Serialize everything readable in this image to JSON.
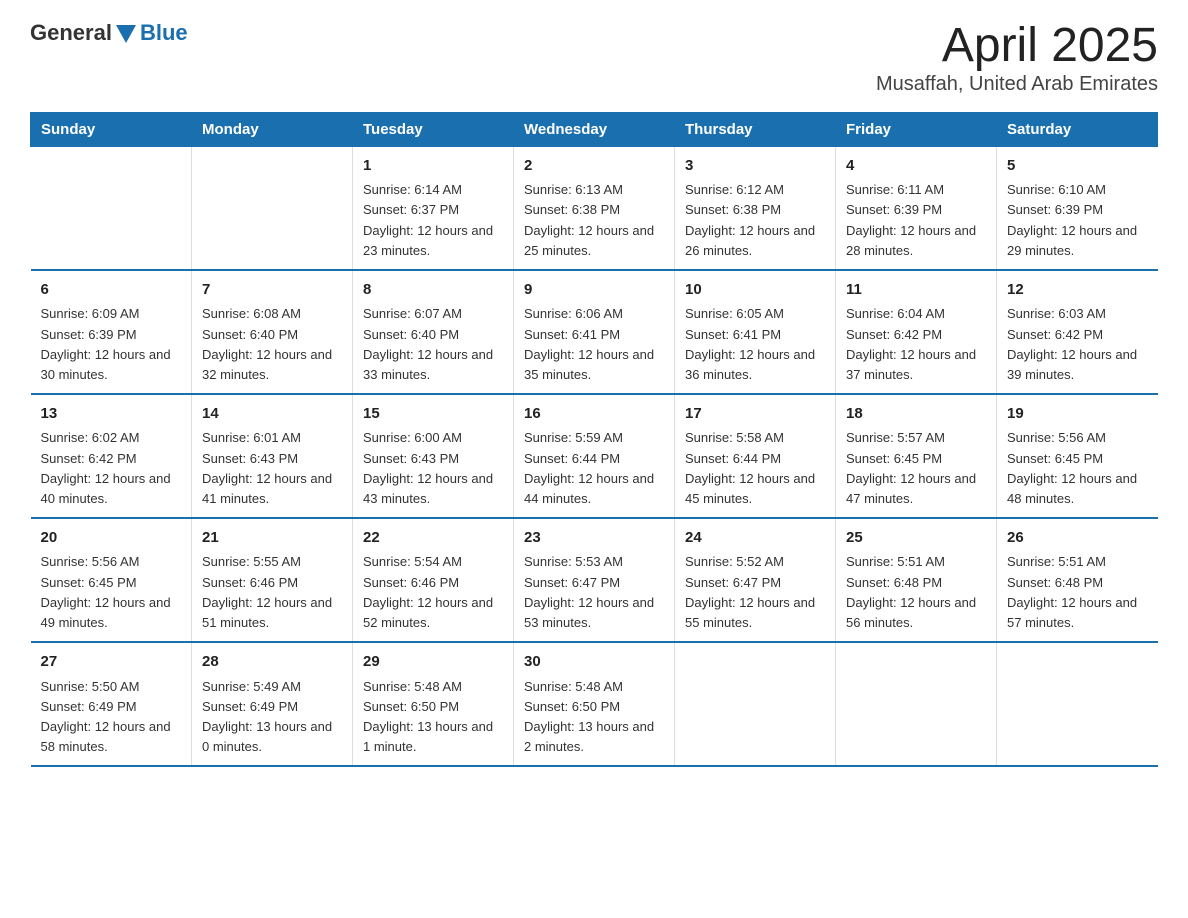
{
  "logo": {
    "general": "General",
    "blue": "Blue"
  },
  "title": "April 2025",
  "subtitle": "Musaffah, United Arab Emirates",
  "headers": [
    "Sunday",
    "Monday",
    "Tuesday",
    "Wednesday",
    "Thursday",
    "Friday",
    "Saturday"
  ],
  "weeks": [
    [
      {
        "day": "",
        "sunrise": "",
        "sunset": "",
        "daylight": ""
      },
      {
        "day": "",
        "sunrise": "",
        "sunset": "",
        "daylight": ""
      },
      {
        "day": "1",
        "sunrise": "Sunrise: 6:14 AM",
        "sunset": "Sunset: 6:37 PM",
        "daylight": "Daylight: 12 hours and 23 minutes."
      },
      {
        "day": "2",
        "sunrise": "Sunrise: 6:13 AM",
        "sunset": "Sunset: 6:38 PM",
        "daylight": "Daylight: 12 hours and 25 minutes."
      },
      {
        "day": "3",
        "sunrise": "Sunrise: 6:12 AM",
        "sunset": "Sunset: 6:38 PM",
        "daylight": "Daylight: 12 hours and 26 minutes."
      },
      {
        "day": "4",
        "sunrise": "Sunrise: 6:11 AM",
        "sunset": "Sunset: 6:39 PM",
        "daylight": "Daylight: 12 hours and 28 minutes."
      },
      {
        "day": "5",
        "sunrise": "Sunrise: 6:10 AM",
        "sunset": "Sunset: 6:39 PM",
        "daylight": "Daylight: 12 hours and 29 minutes."
      }
    ],
    [
      {
        "day": "6",
        "sunrise": "Sunrise: 6:09 AM",
        "sunset": "Sunset: 6:39 PM",
        "daylight": "Daylight: 12 hours and 30 minutes."
      },
      {
        "day": "7",
        "sunrise": "Sunrise: 6:08 AM",
        "sunset": "Sunset: 6:40 PM",
        "daylight": "Daylight: 12 hours and 32 minutes."
      },
      {
        "day": "8",
        "sunrise": "Sunrise: 6:07 AM",
        "sunset": "Sunset: 6:40 PM",
        "daylight": "Daylight: 12 hours and 33 minutes."
      },
      {
        "day": "9",
        "sunrise": "Sunrise: 6:06 AM",
        "sunset": "Sunset: 6:41 PM",
        "daylight": "Daylight: 12 hours and 35 minutes."
      },
      {
        "day": "10",
        "sunrise": "Sunrise: 6:05 AM",
        "sunset": "Sunset: 6:41 PM",
        "daylight": "Daylight: 12 hours and 36 minutes."
      },
      {
        "day": "11",
        "sunrise": "Sunrise: 6:04 AM",
        "sunset": "Sunset: 6:42 PM",
        "daylight": "Daylight: 12 hours and 37 minutes."
      },
      {
        "day": "12",
        "sunrise": "Sunrise: 6:03 AM",
        "sunset": "Sunset: 6:42 PM",
        "daylight": "Daylight: 12 hours and 39 minutes."
      }
    ],
    [
      {
        "day": "13",
        "sunrise": "Sunrise: 6:02 AM",
        "sunset": "Sunset: 6:42 PM",
        "daylight": "Daylight: 12 hours and 40 minutes."
      },
      {
        "day": "14",
        "sunrise": "Sunrise: 6:01 AM",
        "sunset": "Sunset: 6:43 PM",
        "daylight": "Daylight: 12 hours and 41 minutes."
      },
      {
        "day": "15",
        "sunrise": "Sunrise: 6:00 AM",
        "sunset": "Sunset: 6:43 PM",
        "daylight": "Daylight: 12 hours and 43 minutes."
      },
      {
        "day": "16",
        "sunrise": "Sunrise: 5:59 AM",
        "sunset": "Sunset: 6:44 PM",
        "daylight": "Daylight: 12 hours and 44 minutes."
      },
      {
        "day": "17",
        "sunrise": "Sunrise: 5:58 AM",
        "sunset": "Sunset: 6:44 PM",
        "daylight": "Daylight: 12 hours and 45 minutes."
      },
      {
        "day": "18",
        "sunrise": "Sunrise: 5:57 AM",
        "sunset": "Sunset: 6:45 PM",
        "daylight": "Daylight: 12 hours and 47 minutes."
      },
      {
        "day": "19",
        "sunrise": "Sunrise: 5:56 AM",
        "sunset": "Sunset: 6:45 PM",
        "daylight": "Daylight: 12 hours and 48 minutes."
      }
    ],
    [
      {
        "day": "20",
        "sunrise": "Sunrise: 5:56 AM",
        "sunset": "Sunset: 6:45 PM",
        "daylight": "Daylight: 12 hours and 49 minutes."
      },
      {
        "day": "21",
        "sunrise": "Sunrise: 5:55 AM",
        "sunset": "Sunset: 6:46 PM",
        "daylight": "Daylight: 12 hours and 51 minutes."
      },
      {
        "day": "22",
        "sunrise": "Sunrise: 5:54 AM",
        "sunset": "Sunset: 6:46 PM",
        "daylight": "Daylight: 12 hours and 52 minutes."
      },
      {
        "day": "23",
        "sunrise": "Sunrise: 5:53 AM",
        "sunset": "Sunset: 6:47 PM",
        "daylight": "Daylight: 12 hours and 53 minutes."
      },
      {
        "day": "24",
        "sunrise": "Sunrise: 5:52 AM",
        "sunset": "Sunset: 6:47 PM",
        "daylight": "Daylight: 12 hours and 55 minutes."
      },
      {
        "day": "25",
        "sunrise": "Sunrise: 5:51 AM",
        "sunset": "Sunset: 6:48 PM",
        "daylight": "Daylight: 12 hours and 56 minutes."
      },
      {
        "day": "26",
        "sunrise": "Sunrise: 5:51 AM",
        "sunset": "Sunset: 6:48 PM",
        "daylight": "Daylight: 12 hours and 57 minutes."
      }
    ],
    [
      {
        "day": "27",
        "sunrise": "Sunrise: 5:50 AM",
        "sunset": "Sunset: 6:49 PM",
        "daylight": "Daylight: 12 hours and 58 minutes."
      },
      {
        "day": "28",
        "sunrise": "Sunrise: 5:49 AM",
        "sunset": "Sunset: 6:49 PM",
        "daylight": "Daylight: 13 hours and 0 minutes."
      },
      {
        "day": "29",
        "sunrise": "Sunrise: 5:48 AM",
        "sunset": "Sunset: 6:50 PM",
        "daylight": "Daylight: 13 hours and 1 minute."
      },
      {
        "day": "30",
        "sunrise": "Sunrise: 5:48 AM",
        "sunset": "Sunset: 6:50 PM",
        "daylight": "Daylight: 13 hours and 2 minutes."
      },
      {
        "day": "",
        "sunrise": "",
        "sunset": "",
        "daylight": ""
      },
      {
        "day": "",
        "sunrise": "",
        "sunset": "",
        "daylight": ""
      },
      {
        "day": "",
        "sunrise": "",
        "sunset": "",
        "daylight": ""
      }
    ]
  ]
}
